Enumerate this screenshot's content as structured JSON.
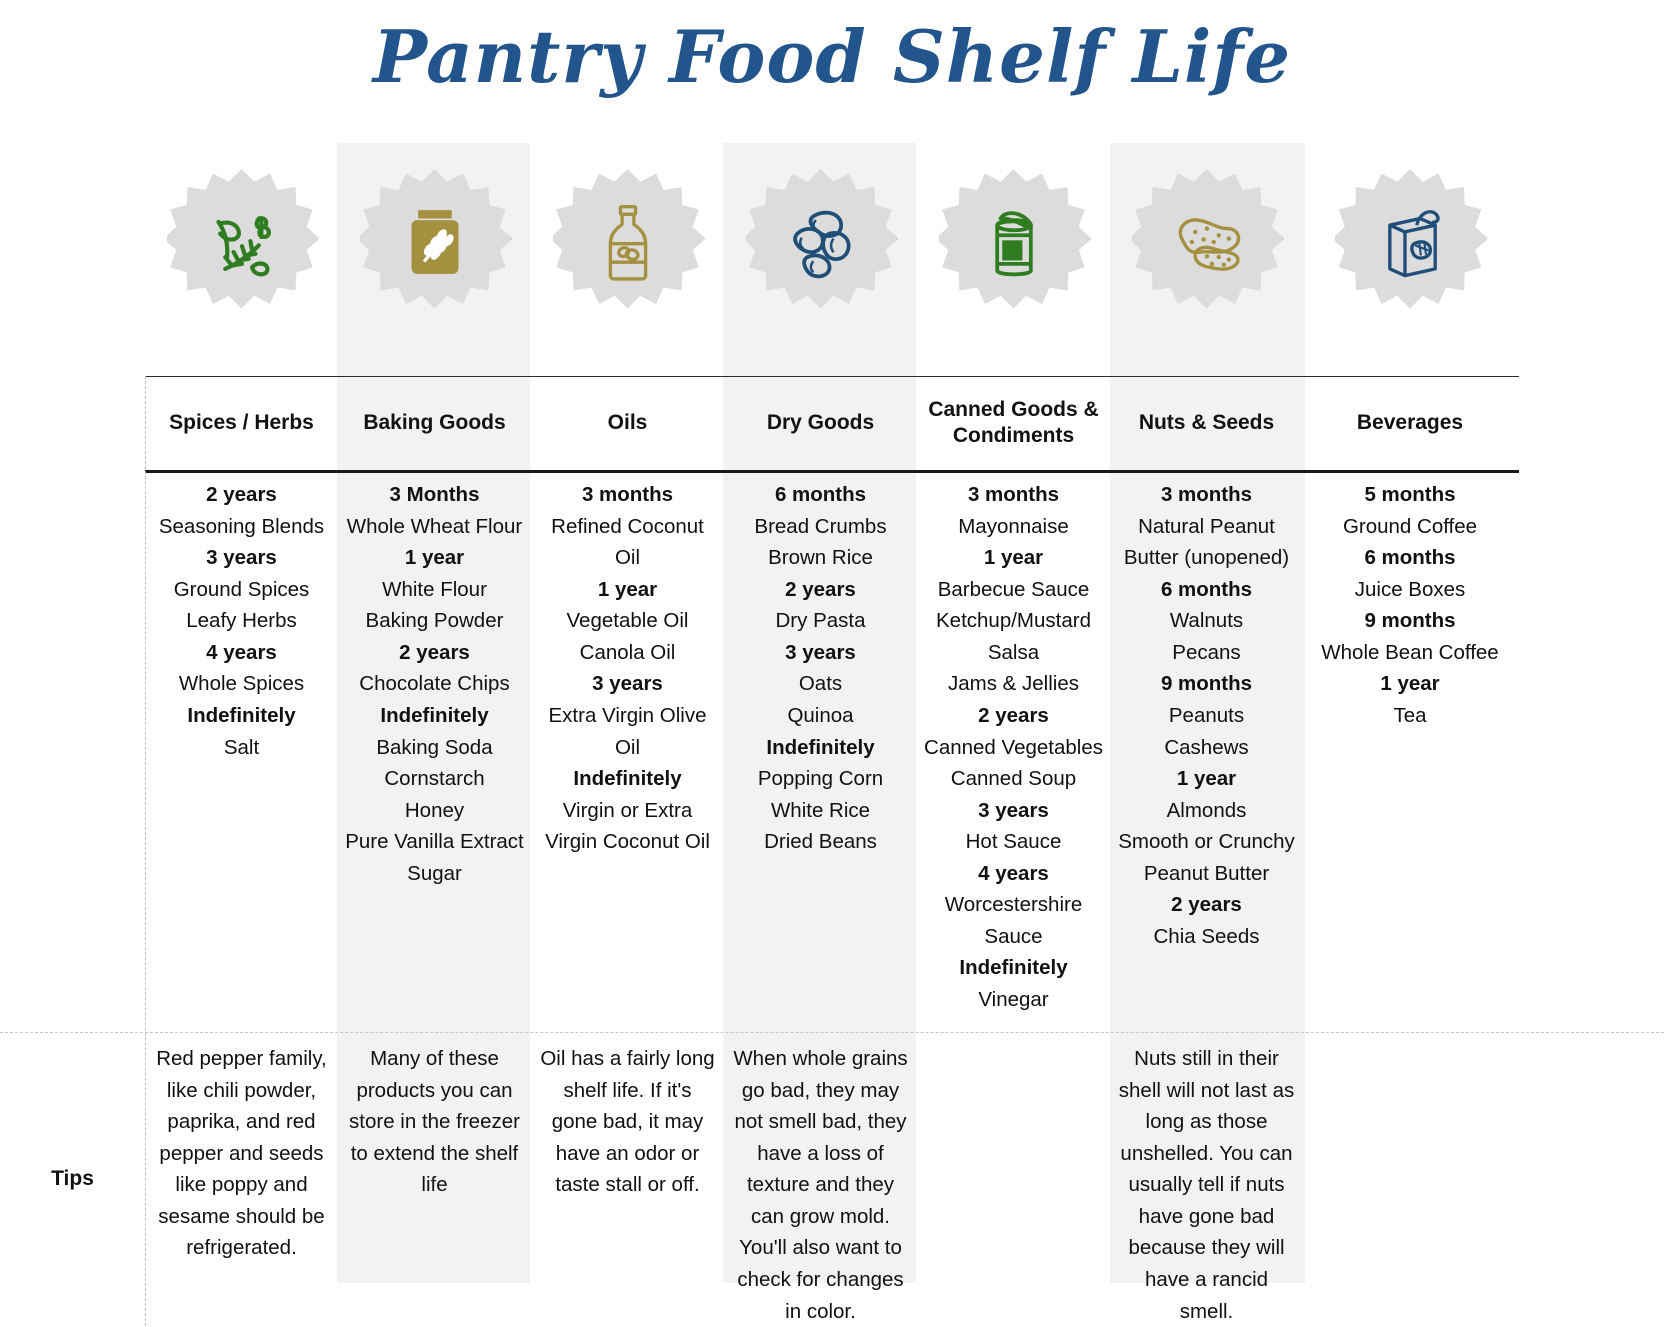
{
  "title": "Pantry Food Shelf Life",
  "colors": {
    "title_navy": "#22558c",
    "stripe_gray": "#f2f2f2",
    "badge_gray": "#dcdcdc",
    "icon_green": "#2f7d20",
    "icon_gold": "#a5903f",
    "icon_navy": "#1f4e79",
    "text_black": "#121212"
  },
  "tips_label": "Tips",
  "columns": [
    {
      "header": "Spices / Herbs",
      "icon": "herbs-icon",
      "icon_color": "#2f7d20",
      "shaded": false,
      "entries": [
        {
          "duration": "2 years",
          "items": [
            "Seasoning Blends"
          ]
        },
        {
          "duration": "3 years",
          "items": [
            "Ground Spices",
            "Leafy Herbs"
          ]
        },
        {
          "duration": "4 years",
          "items": [
            "Whole Spices"
          ]
        },
        {
          "duration": "Indefinitely",
          "items": [
            "Salt"
          ]
        }
      ],
      "tip": "Red pepper family, like chili powder, paprika, and red pepper and seeds like poppy and sesame should be refrigerated."
    },
    {
      "header": "Baking Goods",
      "icon": "flour-bag-icon",
      "icon_color": "#a5903f",
      "shaded": true,
      "entries": [
        {
          "duration": "3 Months",
          "items": [
            "Whole Wheat Flour"
          ]
        },
        {
          "duration": "1 year",
          "items": [
            "White Flour",
            "Baking Powder"
          ]
        },
        {
          "duration": "2 years",
          "items": [
            "Chocolate Chips"
          ]
        },
        {
          "duration": "Indefinitely",
          "items": [
            "Baking Soda",
            "Cornstarch",
            "Honey",
            "Pure Vanilla Extract",
            "Sugar"
          ]
        }
      ],
      "tip": "Many of these products you can store in the freezer to extend the shelf life"
    },
    {
      "header": "Oils",
      "icon": "oil-bottle-icon",
      "icon_color": "#a5903f",
      "shaded": false,
      "entries": [
        {
          "duration": "3 months",
          "items": [
            "Refined Coconut Oil"
          ]
        },
        {
          "duration": "1 year",
          "items": [
            "Vegetable Oil",
            "Canola Oil"
          ]
        },
        {
          "duration": "3 years",
          "items": [
            "Extra Virgin Olive Oil"
          ]
        },
        {
          "duration": "Indefinitely",
          "items": [
            "Virgin or Extra Virgin Coconut Oil"
          ]
        }
      ],
      "tip": "Oil has a fairly long shelf life. If it's gone bad, it may have an odor or taste stall or off."
    },
    {
      "header": "Dry Goods",
      "icon": "beans-icon",
      "icon_color": "#1f4e79",
      "shaded": true,
      "entries": [
        {
          "duration": "6 months",
          "items": [
            "Bread Crumbs",
            "Brown Rice"
          ]
        },
        {
          "duration": "2 years",
          "items": [
            "Dry Pasta"
          ]
        },
        {
          "duration": "3 years",
          "items": [
            "Oats",
            "Quinoa"
          ]
        },
        {
          "duration": "Indefinitely",
          "items": [
            "Popping Corn",
            "White Rice",
            "Dried Beans"
          ]
        }
      ],
      "tip": "When whole grains go bad, they may not smell bad, they have a loss of texture and they can grow mold. You'll also want to check for changes in color."
    },
    {
      "header": "Canned Goods & Condiments",
      "icon": "canned-food-icon",
      "icon_color": "#2f7d20",
      "shaded": false,
      "entries": [
        {
          "duration": "3 months",
          "items": [
            "Mayonnaise"
          ]
        },
        {
          "duration": "1 year",
          "items": [
            "Barbecue Sauce",
            "Ketchup/Mustard",
            "Salsa",
            "Jams & Jellies"
          ]
        },
        {
          "duration": "2 years",
          "items": [
            "Canned Vegetables",
            "Canned Soup"
          ]
        },
        {
          "duration": "3 years",
          "items": [
            "Hot Sauce"
          ]
        },
        {
          "duration": "4 years",
          "items": [
            "Worcestershire Sauce"
          ]
        },
        {
          "duration": "Indefinitely",
          "items": [
            "Vinegar"
          ]
        }
      ],
      "tip": ""
    },
    {
      "header": "Nuts & Seeds",
      "icon": "peanuts-icon",
      "icon_color": "#a5903f",
      "shaded": true,
      "entries": [
        {
          "duration": "3 months",
          "items": [
            "Natural Peanut Butter (unopened)"
          ]
        },
        {
          "duration": "6 months",
          "items": [
            "Walnuts",
            "Pecans"
          ]
        },
        {
          "duration": "9 months",
          "items": [
            "Peanuts",
            "Cashews"
          ]
        },
        {
          "duration": "1 year",
          "items": [
            "Almonds",
            "Smooth or Crunchy Peanut Butter"
          ]
        },
        {
          "duration": "2 years",
          "items": [
            "Chia Seeds"
          ]
        }
      ],
      "tip": "Nuts still in their shell will not last as long as those unshelled. You can usually tell if nuts have gone bad because they will have a rancid smell."
    },
    {
      "header": "Beverages",
      "icon": "juice-box-icon",
      "icon_color": "#1f4e79",
      "shaded": false,
      "entries": [
        {
          "duration": "5 months",
          "items": [
            "Ground Coffee"
          ]
        },
        {
          "duration": "6 months",
          "items": [
            "Juice Boxes"
          ]
        },
        {
          "duration": "9 months",
          "items": [
            "Whole Bean Coffee"
          ]
        },
        {
          "duration": "1 year",
          "items": [
            "Tea"
          ]
        }
      ],
      "tip": ""
    }
  ]
}
